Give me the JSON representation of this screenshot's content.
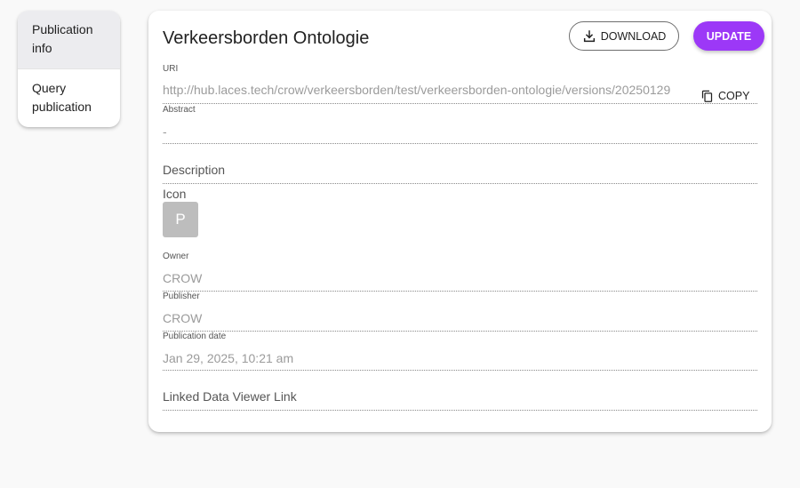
{
  "sidebar": {
    "items": [
      {
        "label_line1": "Publication",
        "label_line2": "info",
        "active": true
      },
      {
        "label_line1": "Query",
        "label_line2": "publication",
        "active": false
      }
    ]
  },
  "header": {
    "title": "Verkeersborden Ontologie",
    "download_label": "DOWNLOAD",
    "update_label": "UPDATE"
  },
  "fields": {
    "uri": {
      "label": "URI",
      "value": "http://hub.laces.tech/crow/verkeersborden/test/verkeersborden-ontologie/versions/20250129",
      "copy_label": "COPY"
    },
    "abstract": {
      "label": "Abstract",
      "value": "-"
    },
    "description": {
      "label": "Description"
    },
    "icon": {
      "label": "Icon",
      "letter": "P"
    },
    "owner": {
      "label": "Owner",
      "value": "CROW"
    },
    "publisher": {
      "label": "Publisher",
      "value": "CROW"
    },
    "publication_date": {
      "label": "Publication date",
      "value": "Jan 29, 2025, 10:21 am"
    },
    "linked_data_viewer": {
      "label": "Linked Data Viewer Link"
    }
  },
  "colors": {
    "accent": "#9c38f7",
    "page_background": "#f9f9f9",
    "nav_active": "#ececef"
  },
  "icons": {
    "download": "download-icon",
    "copy": "copy-icon"
  }
}
